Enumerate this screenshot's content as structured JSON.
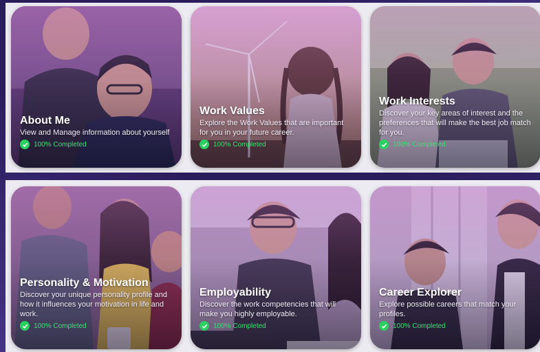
{
  "modules": [
    {
      "title": "About Me",
      "description": "View and Manage information about yourself",
      "status": "100% Completed"
    },
    {
      "title": "Work Values",
      "description": "Explore the Work Values that are important for you in your future career.",
      "status": "100% Completed"
    },
    {
      "title": "Work Interests",
      "description": "Discover your key areas of interest and the preferences that will make the best job match for you.",
      "status": "100% Completed"
    },
    {
      "title": "Personality & Motivation",
      "description": "Discover your unique personality profile and how it influences your motivation in life and work.",
      "status": "100% Completed"
    },
    {
      "title": "Employability",
      "description": "Discover the work competencies that will make you highly employable.",
      "status": "100% Completed"
    },
    {
      "title": "Career Explorer",
      "description": "Explore possible careers that match your profiles.",
      "status": "100% Completed"
    }
  ],
  "colors": {
    "accent": "#2bd160",
    "tint": "#be6ec8",
    "background": "#2a1d5c"
  },
  "icons": {
    "status": "check-circle-icon"
  }
}
